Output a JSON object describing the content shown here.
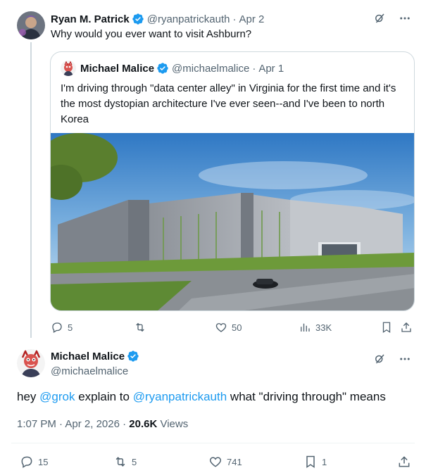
{
  "parent_tweet": {
    "author_name": "Ryan M. Patrick",
    "handle": "@ryanpatrickauth",
    "separator": "·",
    "date": "Apr 2",
    "text": "Why would you ever want to visit Ashburn?",
    "avatar_icon": "avatar-photo",
    "verified_icon": "verified-badge-icon",
    "menu_icon": "more-icon",
    "grok_icon": "grok-icon",
    "quoted": {
      "author_name": "Michael Malice",
      "handle": "@michaelmalice",
      "separator": "·",
      "date": "Apr 1",
      "text": "I'm driving through \"data center alley\" in Virginia for the first time and it's the most dystopian architecture I've ever seen--and I've been to north Korea",
      "image_subject": "data-center-building-photo"
    },
    "actions": {
      "replies": "5",
      "retweets": "",
      "likes": "50",
      "views": "33K"
    }
  },
  "main_tweet": {
    "author_name": "Michael Malice",
    "handle": "@michaelmalice",
    "text_prefix": "hey ",
    "mention_1": "@grok",
    "text_middle": " explain to ",
    "mention_2": "@ryanpatrickauth",
    "text_suffix": " what \"driving through\" means",
    "time": "1:07 PM",
    "date": "Apr 2, 2026",
    "separator": "·",
    "views_count": "20.6K",
    "views_label": " Views",
    "actions": {
      "replies": "15",
      "retweets": "5",
      "likes": "741",
      "bookmarks": "1"
    }
  },
  "colors": {
    "accent": "#1d9bf0",
    "muted": "#536471",
    "border": "#cfd9de",
    "text": "#0f1419"
  }
}
